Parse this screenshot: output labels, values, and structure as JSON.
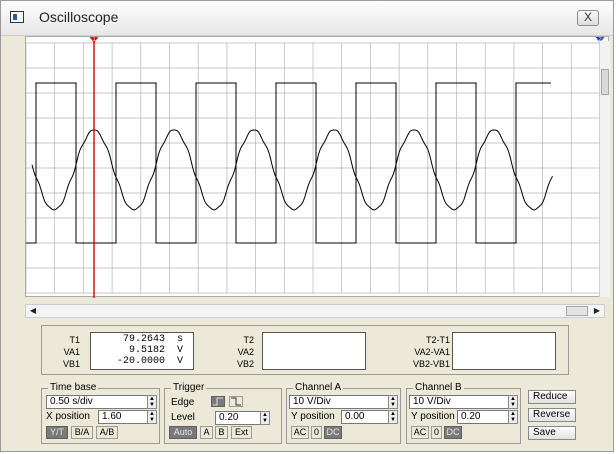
{
  "window": {
    "title": "Oscilloscope",
    "close_label": "X"
  },
  "cursors": {
    "t1_marker": "1",
    "t2_marker": "2"
  },
  "readout": {
    "t1_labels": [
      "T1",
      "VA1",
      "VB1"
    ],
    "t1_values": [
      {
        "value": "79.2643",
        "unit": "s"
      },
      {
        "value": "9.5182",
        "unit": "V"
      },
      {
        "value": "-20.0000",
        "unit": "V"
      }
    ],
    "t2_labels": [
      "T2",
      "VA2",
      "VB2"
    ],
    "diff_labels": [
      "T2-T1",
      "VA2-VA1",
      "VB2-VB1"
    ]
  },
  "timebase": {
    "title": "Time base",
    "scale": "0.50 s/div",
    "xpos_label": "X position",
    "xpos_value": "1.60",
    "modes": [
      "Y/T",
      "B/A",
      "A/B"
    ],
    "active_mode": "Y/T"
  },
  "trigger": {
    "title": "Trigger",
    "edge_label": "Edge",
    "level_label": "Level",
    "level_value": "0.20",
    "sources": [
      "Auto",
      "A",
      "B",
      "Ext"
    ],
    "active_source": "Auto"
  },
  "channel_a": {
    "title": "Channel A",
    "scale": "10 V/Div",
    "ypos_label": "Y position",
    "ypos_value": "0.00",
    "coupling": [
      "AC",
      "0",
      "DC"
    ],
    "active_coupling": "DC"
  },
  "channel_b": {
    "title": "Channel B",
    "scale": "10 V/Div",
    "ypos_label": "Y position",
    "ypos_value": "0.20",
    "coupling": [
      "AC",
      "0",
      "DC"
    ],
    "active_coupling": "DC"
  },
  "actions": {
    "reduce": "Reduce",
    "reverse": "Reverse",
    "save": "Save"
  },
  "colors": {
    "cursor1": "#e00000",
    "cursor2": "#1a3fc0",
    "trace": "#000000",
    "grid": "#b5b5b5"
  }
}
